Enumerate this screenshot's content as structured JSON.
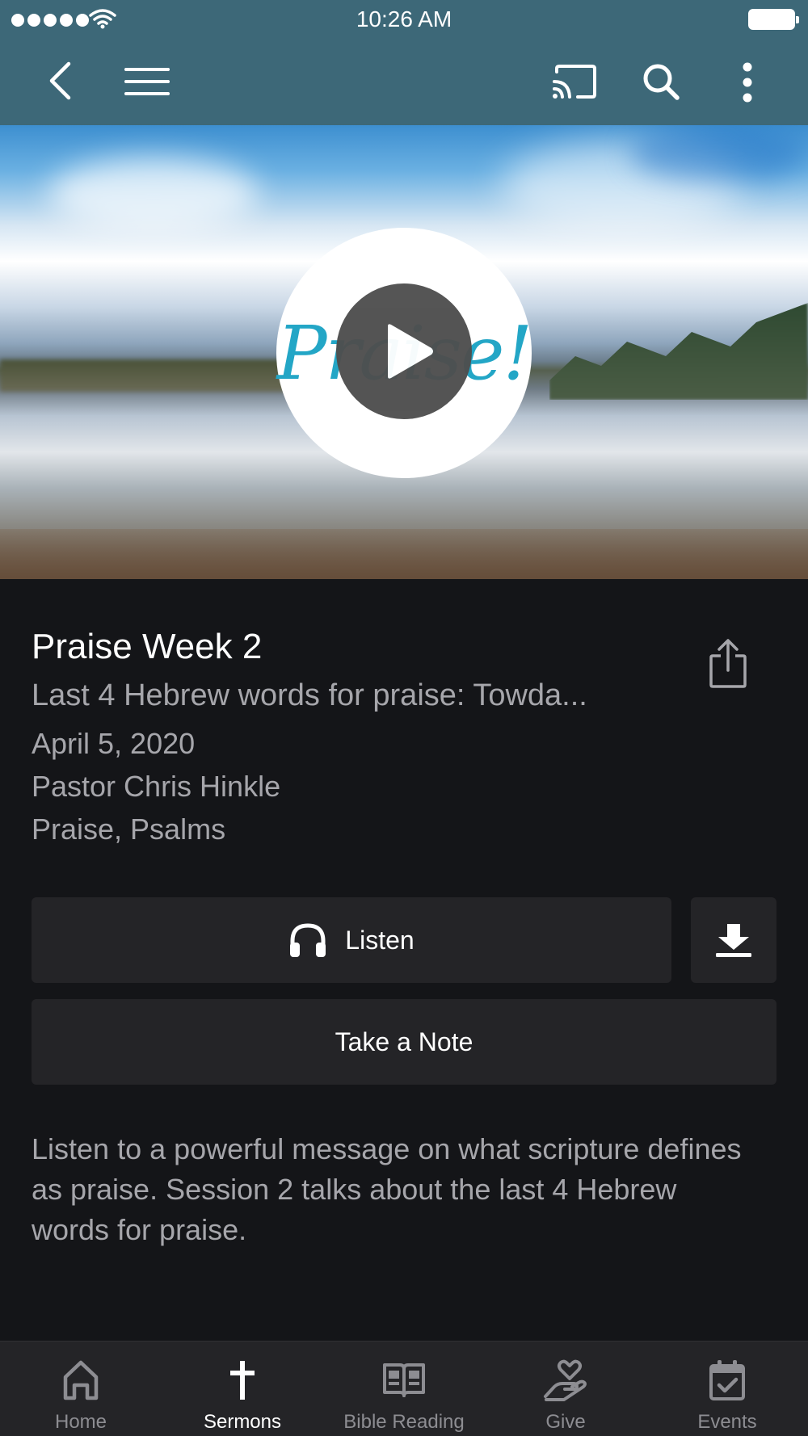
{
  "status_bar": {
    "time": "10:26 AM"
  },
  "app_bar": {
    "icons": [
      "back-arrow-icon",
      "hamburger-menu-icon",
      "cast-icon",
      "search-icon",
      "more-vertical-icon"
    ],
    "color": "#3d6878"
  },
  "hero": {
    "logo_text": "Praise!",
    "logo_color": "#23a6c6"
  },
  "sermon": {
    "title": "Praise Week 2",
    "subtitle": "Last 4 Hebrew words for praise: Towda...",
    "date": "April 5, 2020",
    "speaker": "Pastor Chris Hinkle",
    "topics": "Praise, Psalms",
    "description": "Listen to a powerful message on what scripture defines as praise. Session 2 talks about the last 4 Hebrew words for praise."
  },
  "actions": {
    "listen_label": "Listen",
    "take_note_label": "Take a Note"
  },
  "tabs": [
    {
      "label": "Home",
      "icon": "home-icon",
      "active": false
    },
    {
      "label": "Sermons",
      "icon": "cross-icon",
      "active": true
    },
    {
      "label": "Bible Reading",
      "icon": "book-icon",
      "active": false
    },
    {
      "label": "Give",
      "icon": "heart-hand-icon",
      "active": false
    },
    {
      "label": "Events",
      "icon": "calendar-check-icon",
      "active": false
    }
  ],
  "colors": {
    "background": "#141518",
    "button_bg": "#242427",
    "muted_text": "#a6a6ab"
  }
}
